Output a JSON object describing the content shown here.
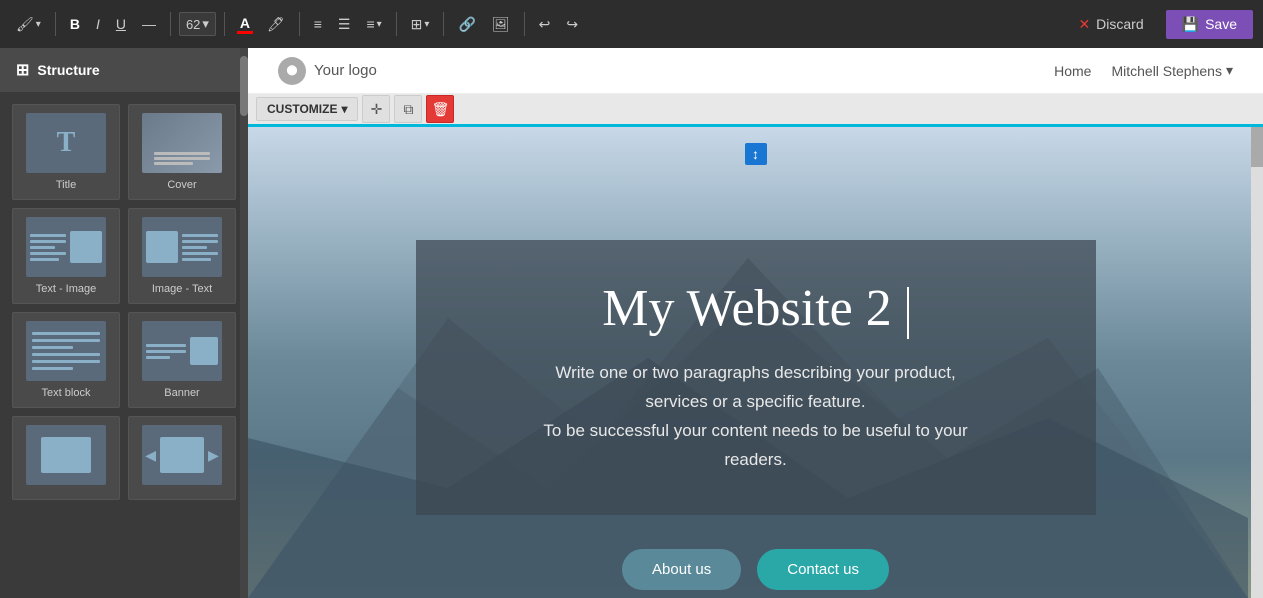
{
  "toolbar": {
    "font_size": "62",
    "font_size_arrow": "▾",
    "bold": "B",
    "italic": "I",
    "underline": "U",
    "strikethrough": "S",
    "brush": "🖌",
    "text_color_label": "A",
    "text_color": "#ff0000",
    "discard_label": "Discard",
    "save_label": "Save",
    "list_ul": "≡",
    "list_ol": "≡",
    "align": "≡",
    "table": "⊞",
    "link": "🔗",
    "image_insert": "🖼",
    "undo": "↩",
    "redo": "↪"
  },
  "sidebar": {
    "header_label": "Structure",
    "blocks": [
      {
        "id": "title",
        "label": "Title"
      },
      {
        "id": "cover",
        "label": "Cover"
      },
      {
        "id": "text-image",
        "label": "Text - Image"
      },
      {
        "id": "image-text",
        "label": "Image - Text"
      },
      {
        "id": "text-block",
        "label": "Text block"
      },
      {
        "id": "banner",
        "label": "Banner"
      },
      {
        "id": "gallery",
        "label": ""
      },
      {
        "id": "slideshow",
        "label": ""
      }
    ]
  },
  "canvas": {
    "site_nav": {
      "logo_text": "Your logo",
      "home_link": "Home",
      "user_name": "Mitchell Stephens",
      "user_arrow": "▾"
    },
    "customize_bar": {
      "customize_label": "CUSTOMIZE",
      "customize_arrow": "▾",
      "move_icon": "✛",
      "copy_icon": "⧉",
      "delete_icon": "🗑"
    },
    "hero": {
      "cursor_indicator": "↕",
      "title": "My Website 2",
      "subtitle_line1": "Write one or two paragraphs describing your product,",
      "subtitle_line2": "services or a specific feature.",
      "subtitle_line3": "To be successful your content needs to be useful to your",
      "subtitle_line4": "readers.",
      "btn_about": "About us",
      "btn_contact": "Contact us"
    }
  }
}
